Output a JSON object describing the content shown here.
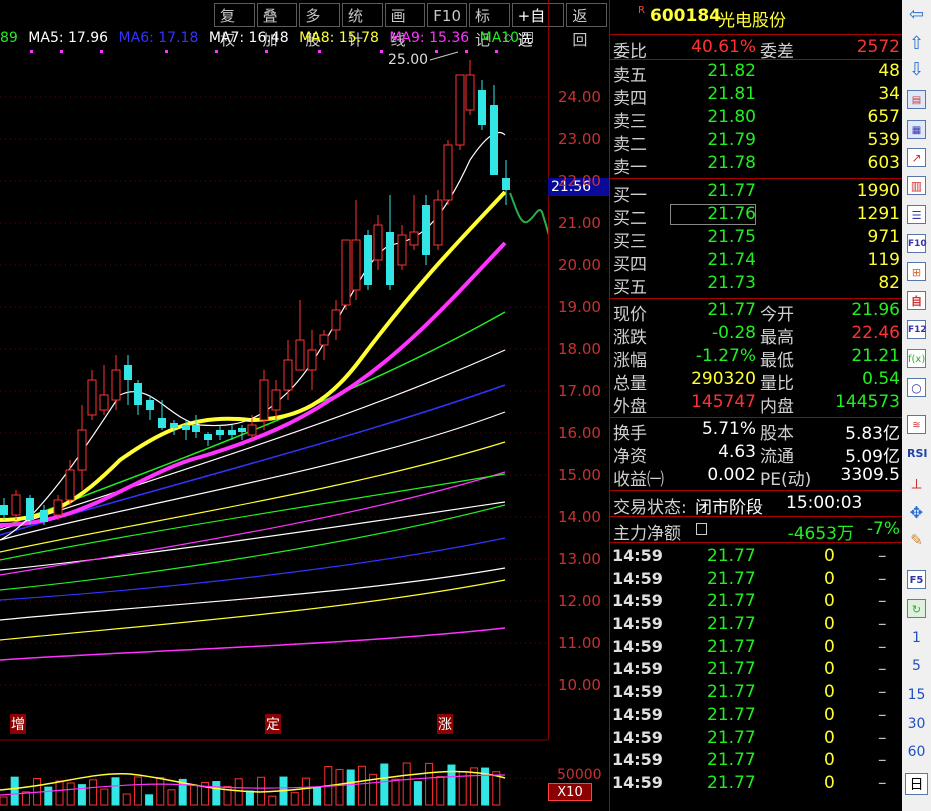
{
  "toolbar": [
    "复权",
    "叠加",
    "多股",
    "统计",
    "画线",
    "F10",
    "标记",
    "+自选",
    "返回"
  ],
  "ma_legend": [
    {
      "text": "89",
      "color": "#22ee22"
    },
    {
      "text": "MA5: 17.96",
      "color": "#ffffff"
    },
    {
      "text": "MA6: 17.18",
      "color": "#3333ff"
    },
    {
      "text": "MA7: 16.48",
      "color": "#ffffff"
    },
    {
      "text": "MA8: 15.78",
      "color": "#ffff33"
    },
    {
      "text": "MA9: 15.36",
      "color": "#ff33ff"
    },
    {
      "text": "MA10",
      "color": "#22ee22"
    }
  ],
  "high_marker": "25.00",
  "current_price": "21.56",
  "price_ticks": [
    "24.00",
    "23.00",
    "22.00",
    "21.00",
    "20.00",
    "19.00",
    "18.00",
    "17.00",
    "16.00",
    "15.00",
    "14.00",
    "13.00",
    "12.00",
    "11.00",
    "10.00"
  ],
  "signals": [
    "增",
    "定",
    "涨"
  ],
  "volume_tick": "50000",
  "volume_multiplier": "X10",
  "stock": {
    "superscript": "R",
    "code": "600184",
    "name": "光电股份"
  },
  "order": {
    "label1": "委比",
    "ratio": "40.61%",
    "label2": "委差",
    "diff": "2572"
  },
  "asks": [
    {
      "label": "卖五",
      "price": "21.82",
      "vol": "48"
    },
    {
      "label": "卖四",
      "price": "21.81",
      "vol": "34"
    },
    {
      "label": "卖三",
      "price": "21.80",
      "vol": "657"
    },
    {
      "label": "卖二",
      "price": "21.79",
      "vol": "539"
    },
    {
      "label": "卖一",
      "price": "21.78",
      "vol": "603"
    }
  ],
  "bids": [
    {
      "label": "买一",
      "price": "21.77",
      "vol": "1990"
    },
    {
      "label": "买二",
      "price": "21.76",
      "vol": "1291"
    },
    {
      "label": "买三",
      "price": "21.75",
      "vol": "971"
    },
    {
      "label": "买四",
      "price": "21.74",
      "vol": "119"
    },
    {
      "label": "买五",
      "price": "21.73",
      "vol": "82"
    }
  ],
  "quote": [
    {
      "l1": "现价",
      "v1": "21.77",
      "c1": "green",
      "l2": "今开",
      "v2": "21.96",
      "c2": "green"
    },
    {
      "l1": "涨跌",
      "v1": "-0.28",
      "c1": "green",
      "l2": "最高",
      "v2": "22.46",
      "c2": "red"
    },
    {
      "l1": "涨幅",
      "v1": "-1.27%",
      "c1": "green",
      "l2": "最低",
      "v2": "21.21",
      "c2": "green"
    },
    {
      "l1": "总量",
      "v1": "290320",
      "c1": "yellow",
      "l2": "量比",
      "v2": "0.54",
      "c2": "green"
    },
    {
      "l1": "外盘",
      "v1": "145747",
      "c1": "red",
      "l2": "内盘",
      "v2": "144573",
      "c2": "green"
    }
  ],
  "fund": [
    {
      "l1": "换手",
      "v1": "5.71%",
      "l2": "股本",
      "v2": "5.83亿"
    },
    {
      "l1": "净资",
      "v1": "4.63",
      "l2": "流通",
      "v2": "5.09亿"
    },
    {
      "l1": "收益㈠",
      "v1": "0.002",
      "l2": "PE(动)",
      "v2": "3309.5"
    }
  ],
  "status": {
    "label": "交易状态:",
    "value": "闭市阶段",
    "time": "15:00:03"
  },
  "netflow": {
    "label": "主力净额",
    "value": "-4653万",
    "pct": "-7%"
  },
  "ticks": [
    {
      "t": "14:59",
      "p": "21.77",
      "v": "0",
      "d": "–"
    },
    {
      "t": "14:59",
      "p": "21.77",
      "v": "0",
      "d": "–"
    },
    {
      "t": "14:59",
      "p": "21.77",
      "v": "0",
      "d": "–"
    },
    {
      "t": "14:59",
      "p": "21.77",
      "v": "0",
      "d": "–"
    },
    {
      "t": "14:59",
      "p": "21.77",
      "v": "0",
      "d": "–"
    },
    {
      "t": "14:59",
      "p": "21.77",
      "v": "0",
      "d": "–"
    },
    {
      "t": "14:59",
      "p": "21.77",
      "v": "0",
      "d": "–"
    },
    {
      "t": "14:59",
      "p": "21.77",
      "v": "0",
      "d": "–"
    },
    {
      "t": "14:59",
      "p": "21.77",
      "v": "0",
      "d": "–"
    },
    {
      "t": "14:59",
      "p": "21.77",
      "v": "0",
      "d": "–"
    },
    {
      "t": "14:59",
      "p": "21.77",
      "v": "0",
      "d": "–"
    }
  ],
  "side_numbers": [
    "1",
    "5",
    "15",
    "30",
    "60"
  ],
  "side_bottom": "日"
}
